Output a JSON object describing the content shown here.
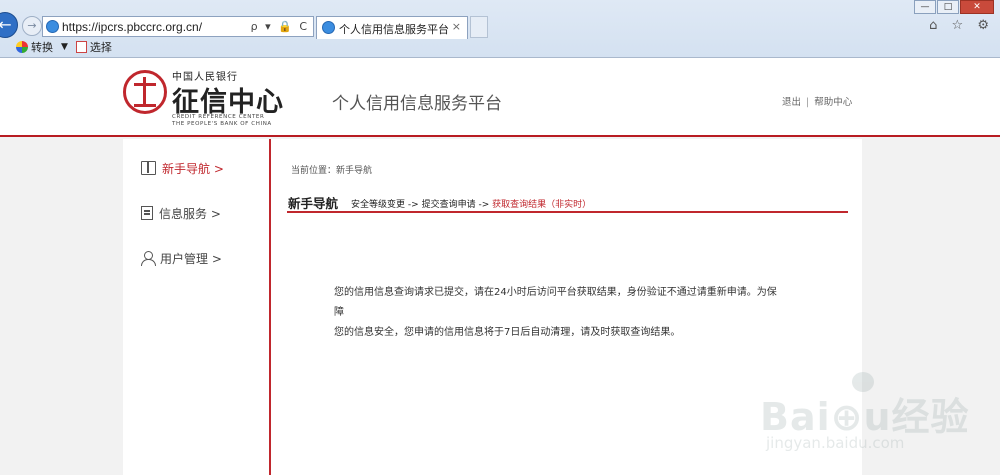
{
  "browser": {
    "url": "https://ipcrs.pbccrc.org.cn/",
    "tab_title": "个人信用信息服务平台",
    "tab_close": "×",
    "addr_tools": "ρ ▾ 🔒 C",
    "commands": {
      "convert": "转换",
      "select": "选择"
    },
    "right_icons": "⌂ ☆ ⚙",
    "window_buttons": {
      "min": "—",
      "max": "□",
      "close": "✕"
    }
  },
  "header": {
    "logo_top": "中国人民银行",
    "logo_main": "征信中心",
    "logo_en_1": "CREDIT REFERENCE CENTER",
    "logo_en_2": "THE PEOPLE'S BANK OF CHINA",
    "platform_title": "个人信用信息服务平台",
    "links": {
      "logout": "退出",
      "separator": "|",
      "help": "帮助中心"
    }
  },
  "sidebar": {
    "items": [
      {
        "label": "新手导航 >",
        "icon": "book-icon",
        "active": true
      },
      {
        "label": "信息服务 >",
        "icon": "document-icon",
        "active": false
      },
      {
        "label": "用户管理 >",
        "icon": "user-icon",
        "active": false
      }
    ]
  },
  "main": {
    "breadcrumb": "当前位置：新手导航",
    "section_title": "新手导航",
    "steps": {
      "step1": "安全等级变更",
      "arrow1": "->",
      "step2": "提交查询申请",
      "arrow2": "->",
      "step3": "获取查询结果（非实时）"
    },
    "message_line1": "您的信用信息查询请求已提交，请在24小时后访问平台获取结果，身份验证不通过请重新申请。为保障",
    "message_line2": "您的信息安全，您申请的信用信息将于7日后自动清理，请及时获取查询结果。"
  },
  "colors": {
    "accent": "#c0272d",
    "text": "#333333"
  },
  "watermark": {
    "brand": "Bai⊕u经验",
    "domain": "jingyan.baidu.com"
  }
}
